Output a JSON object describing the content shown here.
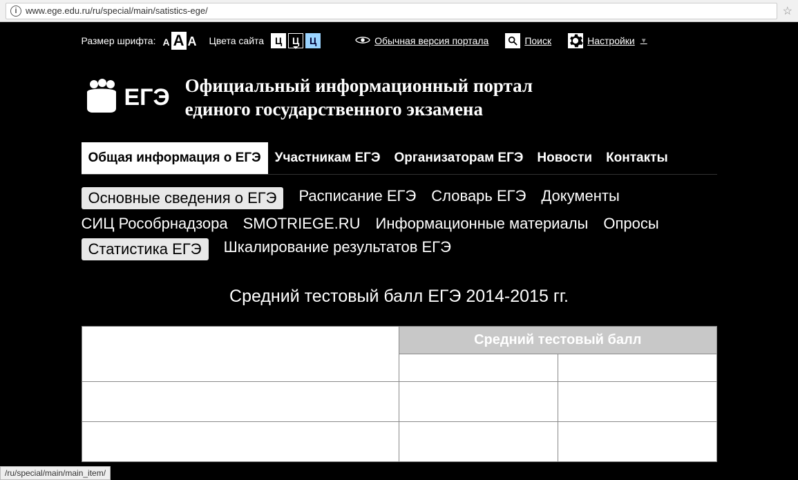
{
  "browser": {
    "url": "www.ege.edu.ru/ru/special/main/satistics-ege/"
  },
  "a11y": {
    "font_label": "Размер шрифта:",
    "font_glyph": "А",
    "colors_label": "Цвета сайта",
    "color_glyph": "Ц",
    "normal_version": "Обычная версия портала",
    "search": "Поиск",
    "settings": "Настройки"
  },
  "header": {
    "logo_text": "ЕГЭ",
    "title_line1": "Официальный информационный портал",
    "title_line2": "единого государственного экзамена"
  },
  "primary_nav": [
    "Общая информация о ЕГЭ",
    "Участникам ЕГЭ",
    "Организаторам ЕГЭ",
    "Новости",
    "Контакты"
  ],
  "sub_nav": [
    "Основные сведения о ЕГЭ",
    "Расписание ЕГЭ",
    "Словарь ЕГЭ",
    "Документы",
    "СИЦ Рособрнадзора",
    "SMOTRIEGE.RU",
    "Информационные материалы",
    "Опросы",
    "Статистика ЕГЭ",
    "Шкалирование результатов ЕГЭ"
  ],
  "content": {
    "heading": "Средний тестовый балл ЕГЭ 2014-2015 гг.",
    "table_header": "Средний тестовый балл"
  },
  "status": "/ru/special/main/main_item/"
}
